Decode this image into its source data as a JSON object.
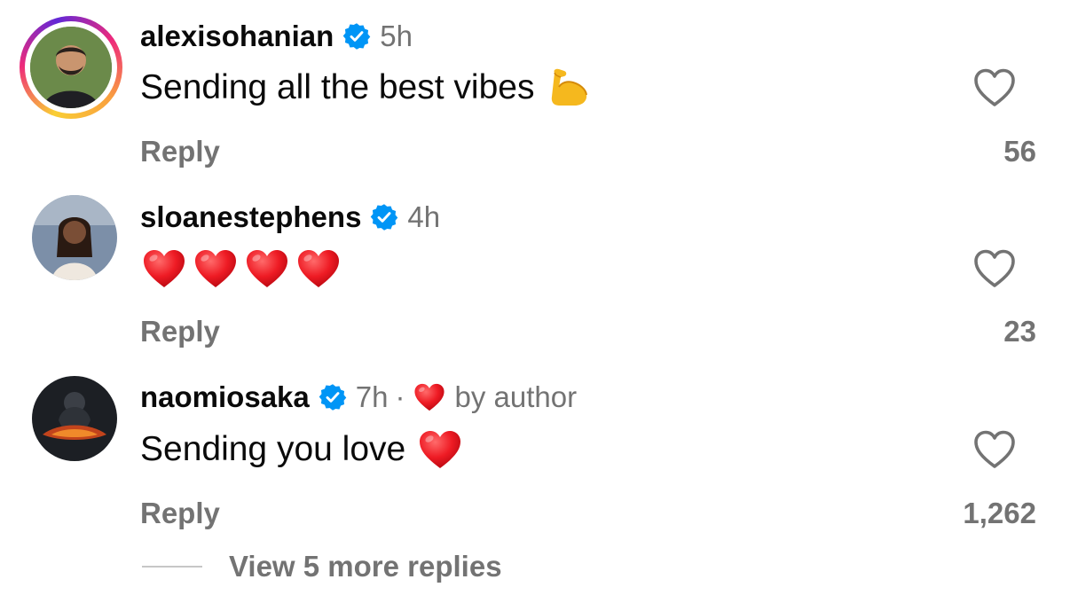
{
  "colors": {
    "text_primary": "#0a0a0a",
    "text_secondary": "#737373",
    "verified_blue": "#0095f6",
    "heart_red": "#ff3040"
  },
  "comments": [
    {
      "username": "alexisohanian",
      "verified": true,
      "time": "5h",
      "text": "Sending all the best vibes",
      "emojis": [
        "flexed-biceps"
      ],
      "reply_label": "Reply",
      "likes": "56",
      "story_ring": true
    },
    {
      "username": "sloanestephens",
      "verified": true,
      "time": "4h",
      "text": "",
      "emojis": [
        "red-heart",
        "red-heart",
        "red-heart",
        "red-heart"
      ],
      "reply_label": "Reply",
      "likes": "23",
      "story_ring": false
    },
    {
      "username": "naomiosaka",
      "verified": true,
      "time": "7h",
      "separator": "·",
      "liked_by_author_label": "by author",
      "text": "Sending you love",
      "emojis": [
        "red-heart"
      ],
      "reply_label": "Reply",
      "likes": "1,262",
      "story_ring": false
    }
  ],
  "view_more_replies": "View 5 more replies"
}
